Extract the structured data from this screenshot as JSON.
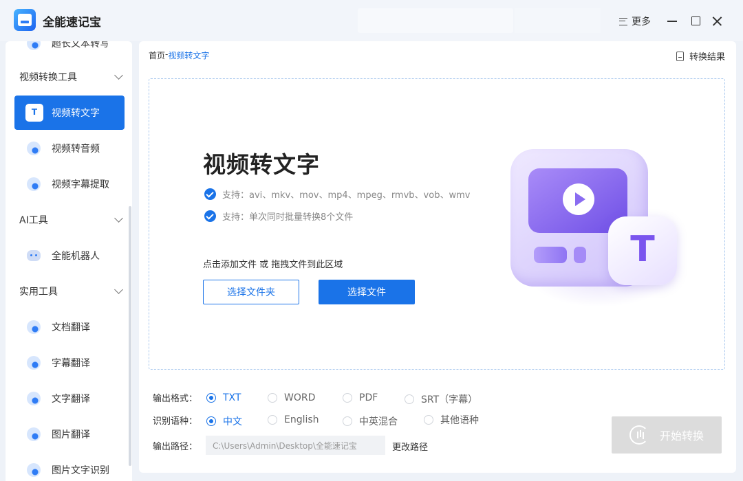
{
  "app": {
    "title": "全能速记宝"
  },
  "window": {
    "more_label": "更多"
  },
  "sidebar": {
    "top_partial_item": "超长文本转写",
    "groups": [
      {
        "label": "视频转换工具",
        "items": [
          "视频转文字",
          "视频转音频",
          "视频字幕提取"
        ]
      },
      {
        "label": "AI工具",
        "items": [
          "全能机器人"
        ]
      },
      {
        "label": "实用工具",
        "items": [
          "文档翻译",
          "字幕翻译",
          "文字翻译",
          "图片翻译",
          "图片文字识别"
        ]
      }
    ],
    "active_item": "视频转文字"
  },
  "main": {
    "breadcrumb": {
      "home": "首页",
      "separator": "-",
      "current": "视频转文字"
    },
    "result_link": "转换结果",
    "dropzone": {
      "title": "视频转文字",
      "support_formats": "支持：avi、mkv、mov、mp4、mpeg、rmvb、vob、wmv",
      "support_batch": "支持：单次同时批量转换8个文件",
      "hint": "点击添加文件 或 拖拽文件到此区域",
      "btn_folder": "选择文件夹",
      "btn_file": "选择文件",
      "illustration_badge": "T"
    },
    "output_format": {
      "label": "输出格式：",
      "options": [
        "TXT",
        "WORD",
        "PDF",
        "SRT（字幕）"
      ],
      "selected": "TXT"
    },
    "language": {
      "label": "识别语种：",
      "options": [
        "中文",
        "English",
        "中英混合",
        "其他语种"
      ],
      "selected": "中文"
    },
    "output_path": {
      "label": "输出路径：",
      "value": "C:\\Users\\Admin\\Desktop\\全能速记宝",
      "change_label": "更改路径"
    },
    "start_button": "开始转换"
  },
  "colors": {
    "accent": "#1a73e8",
    "disabled": "#dcdcdc",
    "illustration": "#7a55ee"
  }
}
